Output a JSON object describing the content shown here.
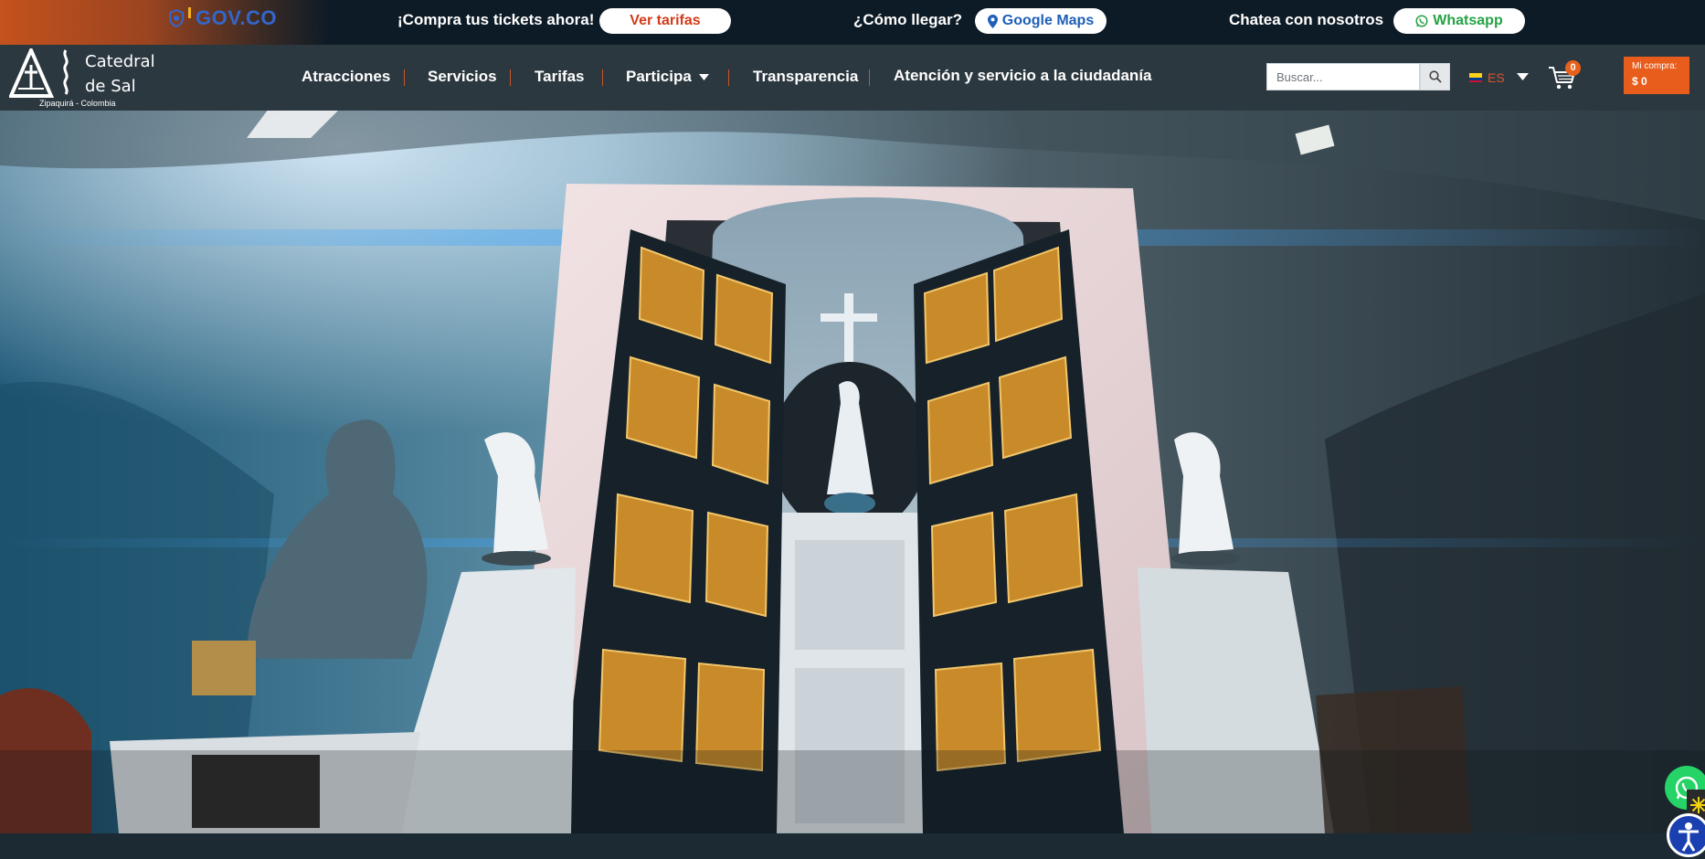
{
  "topbar": {
    "gov_logo": "GOV.CO",
    "buy_prompt": "¡Compra tus tickets ahora!",
    "rates_button": "Ver tarifas",
    "directions_prompt": "¿Cómo llegar?",
    "maps_button": "Google Maps",
    "chat_prompt": "Chatea con nosotros",
    "whatsapp_button": "Whatsapp"
  },
  "brand": {
    "name_line1": "Catedral",
    "name_line2": "de Sal",
    "location": "Zipaquirá - Colombia"
  },
  "nav": {
    "items": [
      "Atracciones",
      "Servicios",
      "Tarifas",
      "Participa",
      "Transparencia",
      "Atención y servicio a la ciudadanía"
    ]
  },
  "search": {
    "placeholder": "Buscar..."
  },
  "language": {
    "code": "ES"
  },
  "cart": {
    "count": "0"
  },
  "purchase": {
    "label": "Mi compra:",
    "amount": "$ 0"
  },
  "colors": {
    "accent": "#e85d1c",
    "topbar_bg": "#0d1b26",
    "navbar_bg": "#2c3840",
    "gov_blue": "#3366cc",
    "whatsapp_green": "#25d366"
  },
  "icons": [
    "gov-shield-icon",
    "map-pin-icon",
    "whatsapp-icon",
    "search-icon",
    "colombia-flag-icon",
    "chevron-down-icon",
    "cart-icon",
    "logo-icon",
    "whatsapp-float-icon",
    "accessibility-icon"
  ]
}
